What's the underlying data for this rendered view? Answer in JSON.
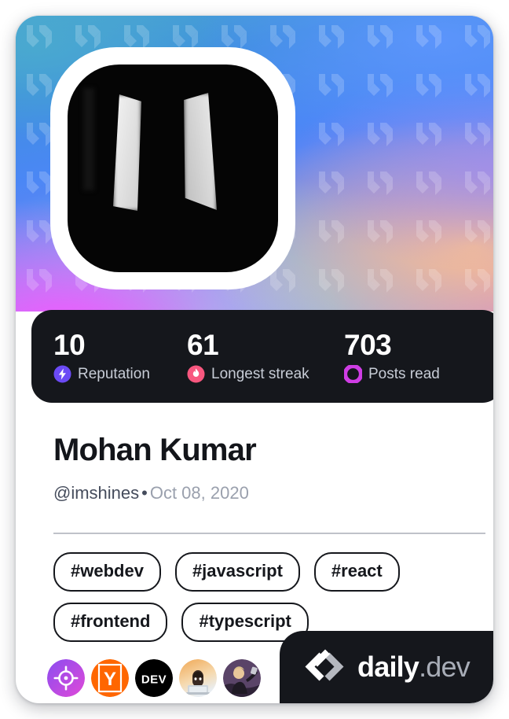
{
  "card": {
    "cover": {
      "watermark_icon": "daily-dev-logo-watermark",
      "gradient_colors": [
        "#4aa6cf",
        "#4b87f5",
        "#6d84f2",
        "#9a7ce8",
        "#ee5aff",
        "#7ee1e4",
        "#ffc48c"
      ]
    },
    "avatar": {
      "alt": "profile-photo"
    },
    "stats": [
      {
        "value": "10",
        "label": "Reputation",
        "icon": "reputation-bolt-icon",
        "color": "#6b4af5"
      },
      {
        "value": "61",
        "label": "Longest streak",
        "icon": "streak-flame-icon",
        "color": "#f8577f"
      },
      {
        "value": "703",
        "label": "Posts read",
        "icon": "posts-read-ring-icon",
        "color": "#cf3de4"
      }
    ],
    "profile": {
      "name": "Mohan Kumar",
      "handle": "@imshines",
      "separator": "•",
      "date": "Oct 08, 2020"
    },
    "tags": [
      "#webdev",
      "#javascript",
      "#react",
      "#frontend",
      "#typescript"
    ],
    "sources": [
      {
        "name": "source-target",
        "icon": "target-crosshair-icon"
      },
      {
        "name": "source-ycombinator",
        "icon": "y-combinator-icon",
        "letter": "Y"
      },
      {
        "name": "source-devto",
        "icon": "dev-to-icon",
        "label": "DEV"
      },
      {
        "name": "source-memoji-avatar",
        "icon": "memoji-avatar-icon"
      },
      {
        "name": "source-photo-avatar",
        "icon": "photo-avatar-icon"
      }
    ],
    "brand": {
      "logo_icon": "daily-dev-chevron-logo",
      "name_primary": "daily",
      "name_secondary": ".dev"
    }
  }
}
